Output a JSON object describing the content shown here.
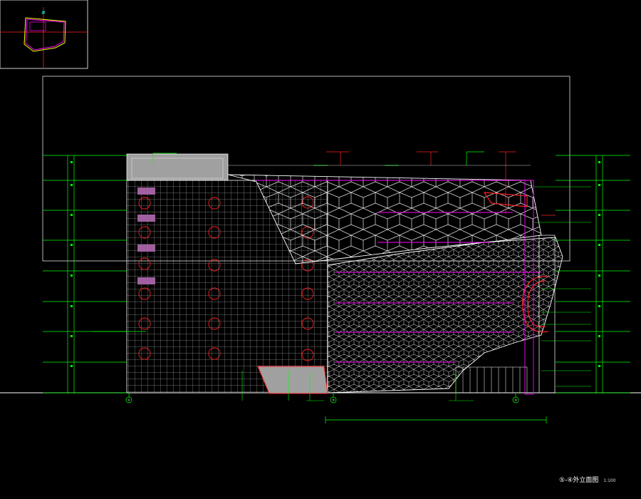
{
  "drawing": {
    "title": "⑤-④外立面图",
    "scale": "1:100"
  },
  "grid_axes": [
    "①",
    "③",
    "④"
  ],
  "colors": {
    "background": "#000000",
    "line_white": "#ffffff",
    "line_green": "#00ff00",
    "line_red": "#ff0000",
    "line_magenta": "#ff00ff",
    "fill_gray": "#a0a0a0",
    "fill_purple": "#a060a0"
  }
}
